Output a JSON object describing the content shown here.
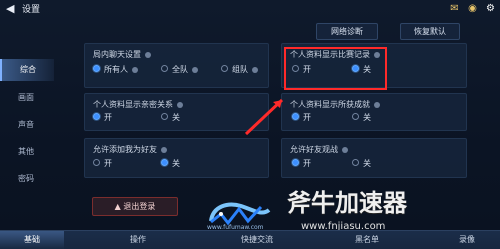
{
  "topbar": {
    "title": "设置",
    "back_icon": "back-arrow-icon",
    "icons": [
      "mail-badge-icon",
      "avatar-badge-icon",
      "settings-icon"
    ]
  },
  "header_buttons": {
    "network": "网络诊断",
    "restore": "恢复默认"
  },
  "sidebar": {
    "items": [
      {
        "label": "综合",
        "active": true
      },
      {
        "label": "画面",
        "active": false
      },
      {
        "label": "声音",
        "active": false
      },
      {
        "label": "其他",
        "active": false
      },
      {
        "label": "密码",
        "active": false
      }
    ]
  },
  "panels": {
    "chat": {
      "title": "局内聊天设置",
      "options": [
        {
          "label": "所有人",
          "selected": true
        },
        {
          "label": "全队",
          "selected": false
        },
        {
          "label": "组队",
          "selected": false
        }
      ]
    },
    "profile_record": {
      "title": "个人资料显示比赛记录",
      "options": [
        {
          "label": "开",
          "selected": false
        },
        {
          "label": "关",
          "selected": true
        }
      ]
    },
    "profile_relations": {
      "title": "个人资料显示亲密关系",
      "options": [
        {
          "label": "开",
          "selected": true
        },
        {
          "label": "关",
          "selected": false
        }
      ]
    },
    "profile_achievements": {
      "title": "个人资料显示所获成就",
      "options": [
        {
          "label": "开",
          "selected": true
        },
        {
          "label": "关",
          "selected": false
        }
      ]
    },
    "friend_add": {
      "title": "允许添加我为好友",
      "options": [
        {
          "label": "开",
          "selected": false
        },
        {
          "label": "关",
          "selected": true
        }
      ]
    },
    "friend_watch": {
      "title": "允许好友观战",
      "options": [
        {
          "label": "开",
          "selected": true
        },
        {
          "label": "关",
          "selected": false
        }
      ]
    }
  },
  "logout": {
    "label": "退出登录"
  },
  "bottom_tabs": [
    {
      "label": "基础",
      "active": true
    },
    {
      "label": "操作",
      "active": false
    },
    {
      "label": "快捷交流",
      "active": false
    },
    {
      "label": "黑名单",
      "active": false
    },
    {
      "label": "录像",
      "active": false
    }
  ],
  "watermark": {
    "logo_text": "www.fufumaw.com",
    "brand": "斧牛加速器",
    "url": "www.fnjiasu.com"
  },
  "colors": {
    "accent": "#3d8fff",
    "highlight": "#ff2a2a",
    "panel": "#17263e"
  }
}
